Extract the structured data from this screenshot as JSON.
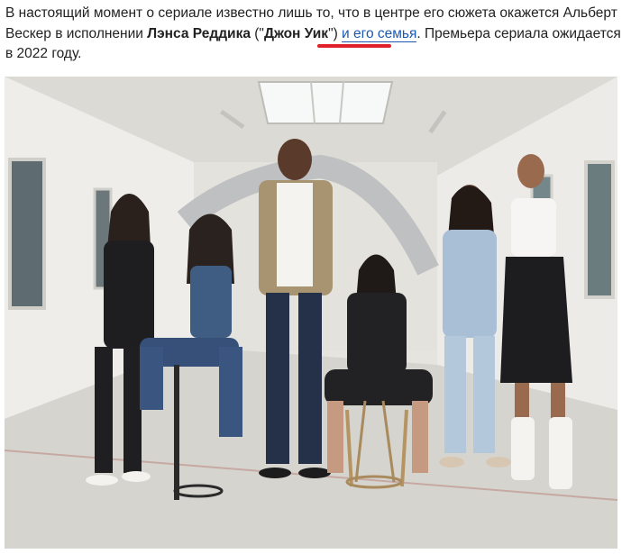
{
  "paragraph": {
    "text_1": "В настоящий момент о сериале известно лишь то, что в центре его сюжета окажется Альберт Вескер в исполнении ",
    "actor": "Лэнса Реддика",
    "text_2": " (\"",
    "film": "Джон Уик",
    "text_3": "\") ",
    "link": "и его семья",
    "text_4": ". Премьера сериала ожидается в 2022 году."
  },
  "colors": {
    "link": "#1c58b0",
    "highlight_underline": "#e0202a"
  },
  "photo": {
    "description_icon": "cast-photo-image"
  }
}
